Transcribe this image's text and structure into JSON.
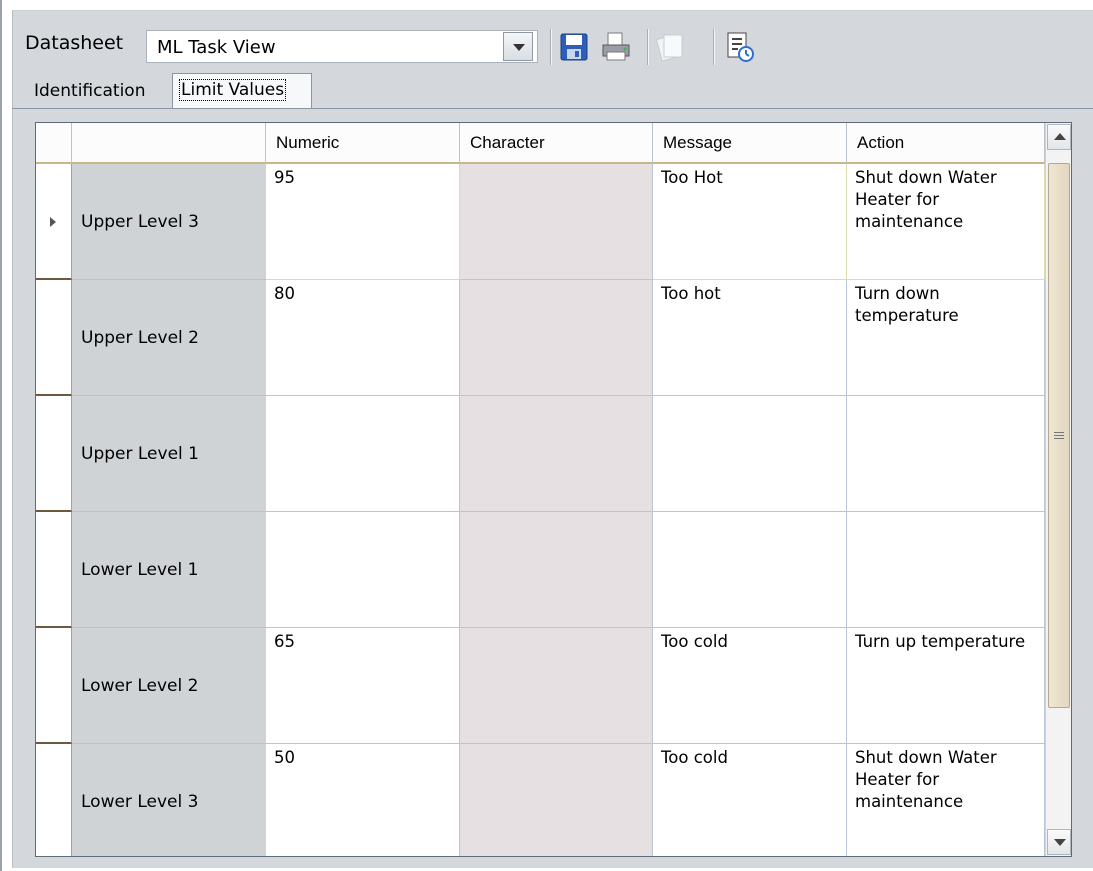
{
  "toolbar": {
    "label": "Datasheet",
    "selected_view": "ML Task View",
    "icons": [
      "save-icon",
      "print-icon",
      "disabled-copy-icon",
      "history-icon"
    ]
  },
  "tabs": [
    {
      "label": "Identification",
      "selected": false
    },
    {
      "label": "Limit Values",
      "selected": true
    }
  ],
  "grid": {
    "columns": [
      "",
      "Numeric",
      "Character",
      "Message",
      "Action"
    ],
    "rows": [
      {
        "label": "Upper Level 3",
        "numeric": "95",
        "character": "",
        "message": "Too Hot",
        "action": "Shut down Water Heater for maintenance",
        "current": true
      },
      {
        "label": "Upper Level 2",
        "numeric": "80",
        "character": "",
        "message": "Too hot",
        "action": "Turn down temperature"
      },
      {
        "label": "Upper Level 1",
        "numeric": "",
        "character": "",
        "message": "",
        "action": ""
      },
      {
        "label": "Lower Level 1",
        "numeric": "",
        "character": "",
        "message": "",
        "action": ""
      },
      {
        "label": "Lower Level 2",
        "numeric": "65",
        "character": "",
        "message": "Too cold",
        "action": "Turn up temperature"
      },
      {
        "label": "Lower Level 3",
        "numeric": "50",
        "character": "",
        "message": "Too cold",
        "action": "Shut down Water Heater for maintenance"
      }
    ]
  },
  "colors": {
    "panel": "#d4d8dc",
    "row_header": "#d0d3d6",
    "character_cell": "#e7e0e3"
  }
}
